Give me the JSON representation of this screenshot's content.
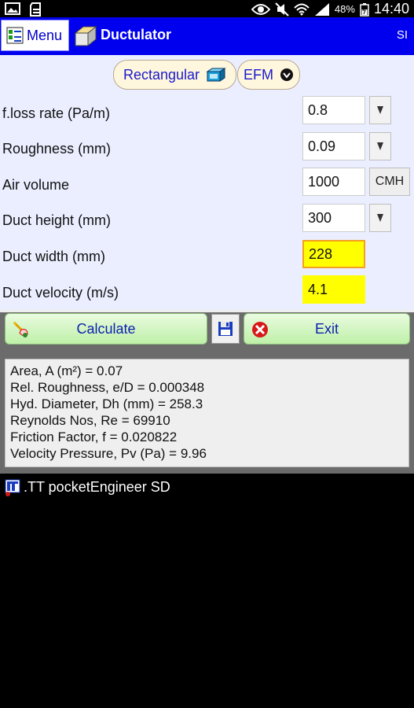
{
  "status_bar": {
    "battery": "48%",
    "time": "14:40"
  },
  "header": {
    "menu_label": "Menu",
    "title": "Ductulator",
    "units": "SI"
  },
  "selectors": {
    "shape": "Rectangular",
    "method": "EFM"
  },
  "form": {
    "rows": [
      {
        "label": "f.loss rate (Pa/m)",
        "value": "0.8"
      },
      {
        "label": "Roughness (mm)",
        "value": "0.09"
      },
      {
        "label": "Air volume",
        "value": "1000",
        "unit_button": "CMH"
      },
      {
        "label": "Duct height (mm)",
        "value": "300"
      },
      {
        "label": "Duct width (mm)",
        "value": "228"
      },
      {
        "label": "Duct velocity (m/s)",
        "value": "4.1"
      }
    ]
  },
  "buttons": {
    "calculate": "Calculate",
    "exit": "Exit"
  },
  "results": [
    "Area, A (m²) = 0.07",
    "Rel. Roughness, e/D = 0.000348",
    "Hyd. Diameter, Dh (mm) = 258.3",
    "Reynolds Nos, Re = 69910",
    "Friction Factor, f = 0.020822",
    "Velocity Pressure, Pv (Pa) = 9.96"
  ],
  "footer": {
    "text": ".TT pocketEngineer SD"
  },
  "colors": {
    "header_bg": "#0000ee",
    "form_bg": "#ebeeff",
    "highlight": "#ffff00",
    "button_green": "#bff0a8"
  }
}
